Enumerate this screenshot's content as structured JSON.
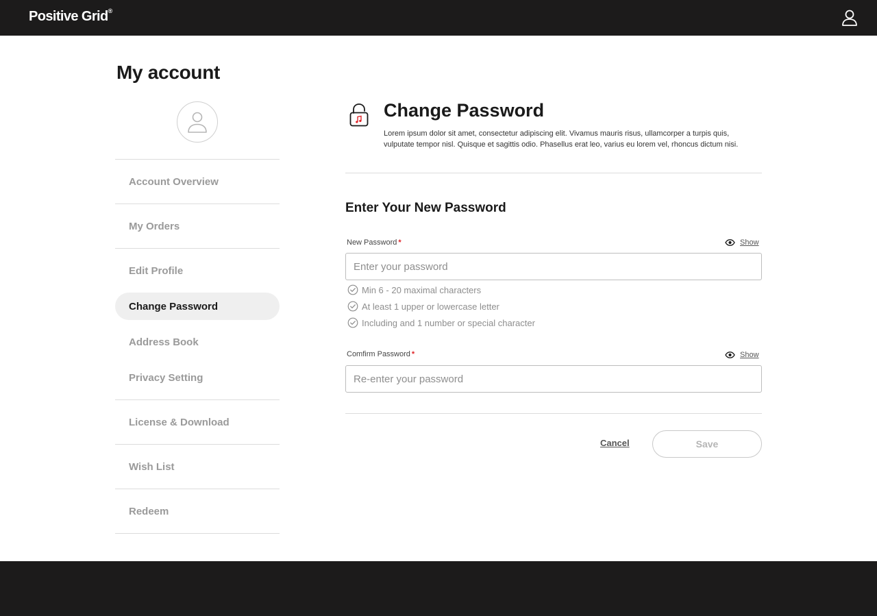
{
  "header": {
    "logo_text": "Positive Grid",
    "logo_mark": "®",
    "user_icon": "user-icon"
  },
  "page": {
    "title": "My account"
  },
  "sidebar": {
    "avatar_icon": "avatar-icon",
    "items": [
      {
        "label": "Account Overview",
        "active": false
      },
      {
        "label": "My Orders",
        "active": false
      },
      {
        "label": "Edit Profile",
        "active": false
      },
      {
        "label": "Change Password",
        "active": true
      },
      {
        "label": "Address Book",
        "active": false
      },
      {
        "label": "Privacy Setting",
        "active": false
      },
      {
        "label": "License & Download",
        "active": false
      },
      {
        "label": "Wish List",
        "active": false
      },
      {
        "label": "Redeem",
        "active": false
      }
    ]
  },
  "main": {
    "icon": "lock-icon",
    "title": "Change Password",
    "description": "Lorem ipsum dolor sit amet, consectetur adipiscing elit. Vivamus mauris risus, ullamcorper a turpis quis, vulputate tempor nisl. Quisque et sagittis odio. Phasellus erat leo, varius eu lorem vel, rhoncus dictum nisi.",
    "form_title": "Enter Your New Password",
    "new_password": {
      "label": "New Password",
      "required_mark": "*",
      "show_label": "Show",
      "value": "",
      "placeholder": "Enter your password",
      "rules": [
        "Min 6 - 20 maximal characters",
        "At least 1 upper or lowercase letter",
        "Including and 1 number or special character"
      ]
    },
    "confirm_password": {
      "label": "Comfirm Password",
      "required_mark": "*",
      "show_label": "Show",
      "value": "",
      "placeholder": "Re-enter your password"
    },
    "actions": {
      "cancel_label": "Cancel",
      "save_label": "Save"
    }
  },
  "colors": {
    "header_bg": "#1c1b1b",
    "required": "#e0262b",
    "active_item_bg": "#efefef",
    "muted_text": "#9a9a9a"
  }
}
